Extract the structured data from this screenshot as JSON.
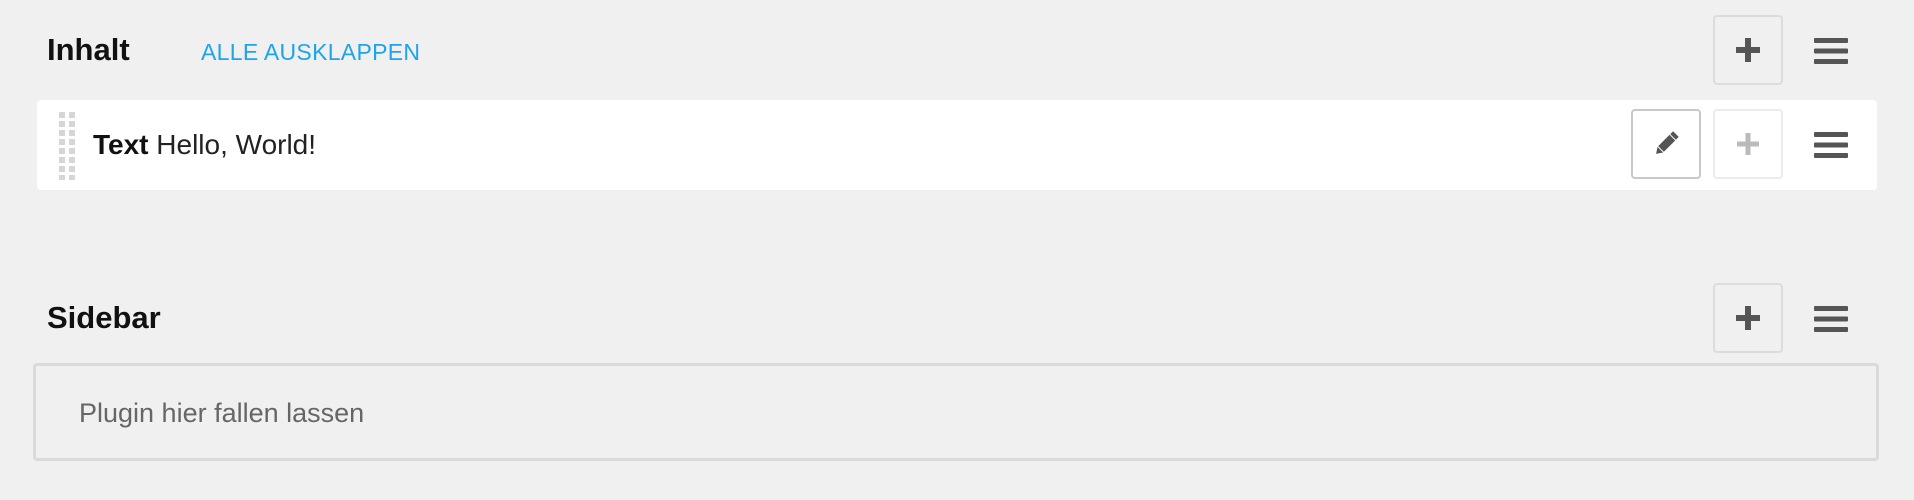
{
  "sections": [
    {
      "title": "Inhalt",
      "expand_all_label": "ALLE AUSKLAPPEN",
      "plugins": [
        {
          "type": "Text",
          "content": "Hello, World!"
        }
      ]
    },
    {
      "title": "Sidebar",
      "dropzone_text": "Plugin hier fallen lassen"
    }
  ],
  "icons": {
    "add": "plus-icon",
    "menu": "hamburger-icon",
    "edit": "pencil-icon",
    "drag": "drag-handle-icon"
  },
  "colors": {
    "background": "#f0f0f0",
    "link": "#1ea4ec",
    "icon": "#555555",
    "icon_disabled": "#bbbbbb"
  }
}
